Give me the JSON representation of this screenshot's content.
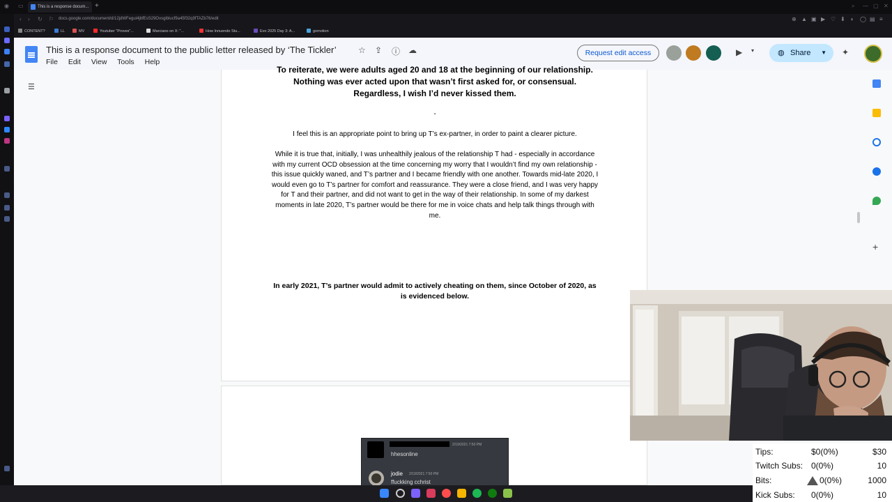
{
  "browser": {
    "tab_title": "This is a response docum...",
    "url": "docs.google.com/document/d/12jdWFegui4jbfEsS29Ovsgiblucf9a45f32q9fTAZb76/edit",
    "bookmarks": [
      "CONTENT?",
      "LL",
      "MV",
      "Youtuber \"Proves\"...",
      "Marciano on X: \"...",
      "How Innuendo Stu...",
      "Evo 2025 Day 3: A...",
      "gomotion"
    ]
  },
  "docs": {
    "title": "This is a response document to the public letter released by ‘The Tickler’",
    "menu": [
      "File",
      "Edit",
      "View",
      "Tools",
      "Help"
    ],
    "request_edit": "Request edit access",
    "share": "Share",
    "paragraphs": {
      "p1": "To reiterate, we were adults aged 20 and 18 at the beginning of our relationship. Nothing was ever acted upon that wasn’t first asked for, or consensual. Regardless, I wish I’d never kissed them.",
      "dash": "-",
      "p2": "I feel this is an appropriate point to bring up T’s ex-partner, in order to paint a clearer picture.",
      "p3": "While it is true that, initially, I was unhealthily jealous of the relationship T had - especially in accordance with my current OCD obsession at the time concerning my worry that I wouldn’t find my own relationship - this issue quickly waned, and T’s partner and I became friendly with one another. Towards mid-late 2020, I would even go to T’s partner for comfort and reassurance. They were a close friend, and I was very happy for T and their partner, and did not want to get in the way of their relationship. In some of my darkest moments in late 2020, T’s partner would be there for me in voice chats and help talk things through with me.",
      "p4": "In early 2021, T’s partner would admit to actively cheating on them, since October of 2020, as is evidenced below."
    },
    "discord": {
      "msg1_time": "2/19/2021 7:50 PM",
      "msg1_text": "hhesonline",
      "msg2_user": "jodie",
      "msg2_time": "2/19/2021 7:50 PM",
      "msg2_text": "ffuckking cchrist"
    }
  },
  "stats": {
    "rows": [
      {
        "label": "Tips:",
        "current": "$0(0%)",
        "goal": "$30"
      },
      {
        "label": "Twitch Subs:",
        "current": "0(0%)",
        "goal": "10"
      },
      {
        "label": "Bits:",
        "current": "0(0%)",
        "goal": "1000"
      },
      {
        "label": "Kick Subs:",
        "current": "0(0%)",
        "goal": "10"
      }
    ]
  },
  "colors": {
    "docs_blue": "#4285f4",
    "share_bg": "#c2e7ff",
    "request_text": "#0b57d0"
  }
}
